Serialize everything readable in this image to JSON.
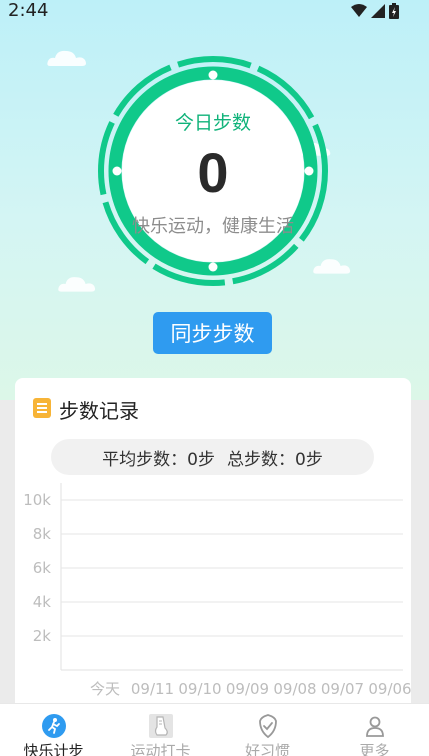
{
  "status_bar": {
    "time": "2:44"
  },
  "ring": {
    "title": "今日步数",
    "steps": "0",
    "slogan": "快乐运动，健康生活"
  },
  "sync_button": {
    "label": "同步步数"
  },
  "records": {
    "title": "步数记录",
    "average": "平均步数：0步",
    "total": "总步数：0步"
  },
  "chart_data": {
    "type": "line",
    "categories": [
      "今天",
      "09/11",
      "09/10",
      "09/09",
      "09/08",
      "09/07",
      "09/06"
    ],
    "series": [
      {
        "values": [
          0,
          0,
          0,
          0,
          0,
          0,
          0
        ]
      }
    ],
    "y_ticks": [
      "2k",
      "4k",
      "6k",
      "8k",
      "10k"
    ],
    "ylim": [
      0,
      11000
    ],
    "grid": true
  },
  "tabbar": {
    "tabs": [
      {
        "label": "快乐计步",
        "icon": "runner-icon",
        "active": true
      },
      {
        "label": "运动打卡",
        "icon": "shoe-icon",
        "active": false
      },
      {
        "label": "好习惯",
        "icon": "shield-check-icon",
        "active": false
      },
      {
        "label": "更多",
        "icon": "user-icon",
        "active": false
      }
    ]
  },
  "colors": {
    "ring_green": "#10c98a",
    "button_blue": "#2f9bf0",
    "tab_active": "#2f9bf0",
    "card_icon": "#f7b437"
  }
}
